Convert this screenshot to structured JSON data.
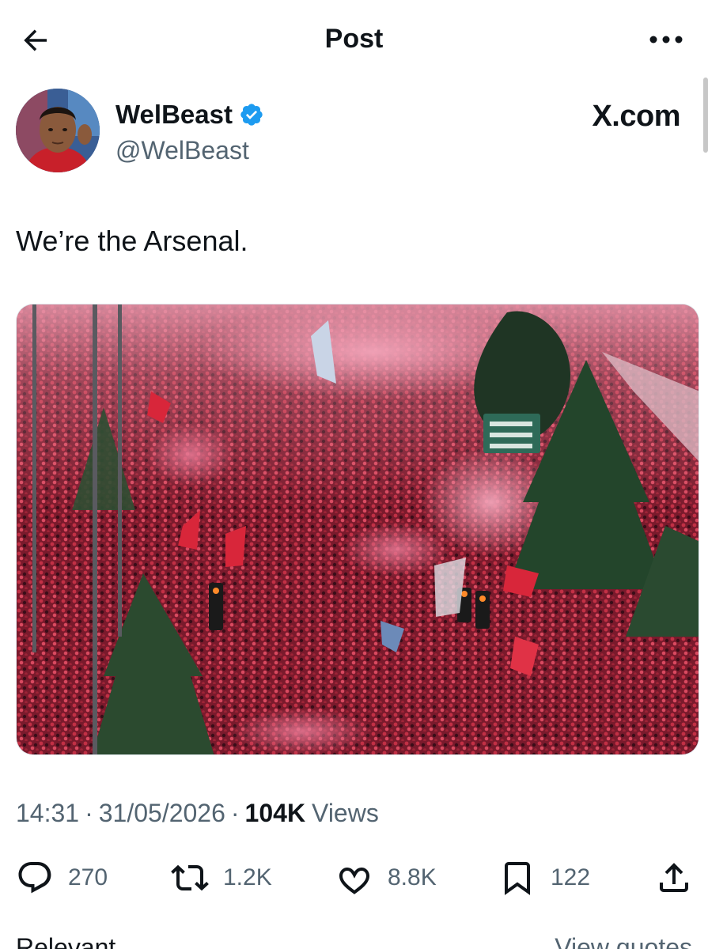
{
  "header": {
    "title": "Post",
    "back_icon": "arrow-left-icon",
    "more_icon": "more-horizontal-icon"
  },
  "author": {
    "display_name": "WelBeast",
    "handle": "@WelBeast",
    "verified": true,
    "verified_color": "#1d9bf0"
  },
  "source_tag": "X.com",
  "post": {
    "text": "We’re the Arsenal."
  },
  "meta": {
    "time": "14:31",
    "date": "31/05/2026",
    "views_count": "104K",
    "views_label": "Views"
  },
  "actions": {
    "replies": "270",
    "reposts": "1.2K",
    "likes": "8.8K",
    "bookmarks": "122"
  },
  "bottom": {
    "left": "Relevant",
    "right": "View quotes"
  },
  "colors": {
    "text": "#0f1419",
    "secondary": "#536471",
    "crowd_red": "#b0203a",
    "smoke_pink": "#e58aa4"
  }
}
